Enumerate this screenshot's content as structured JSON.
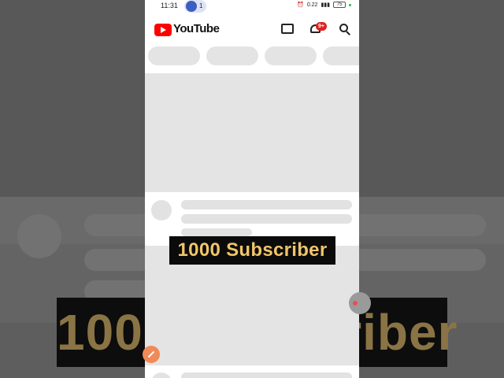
{
  "status_bar": {
    "time": "11:31",
    "notification_count": "1",
    "data_speed": "0.22",
    "battery": "75"
  },
  "app": {
    "brand": "YouTube",
    "notification_badge": "9+",
    "brand_color": "#ff0000"
  },
  "icons": {
    "cast": "cast-icon",
    "notifications": "bell-icon",
    "search": "search-icon"
  },
  "overlay": {
    "caption": "1000 Subscriber",
    "background_caption": "1000 Subscriber",
    "caption_color": "#f0c56a"
  }
}
